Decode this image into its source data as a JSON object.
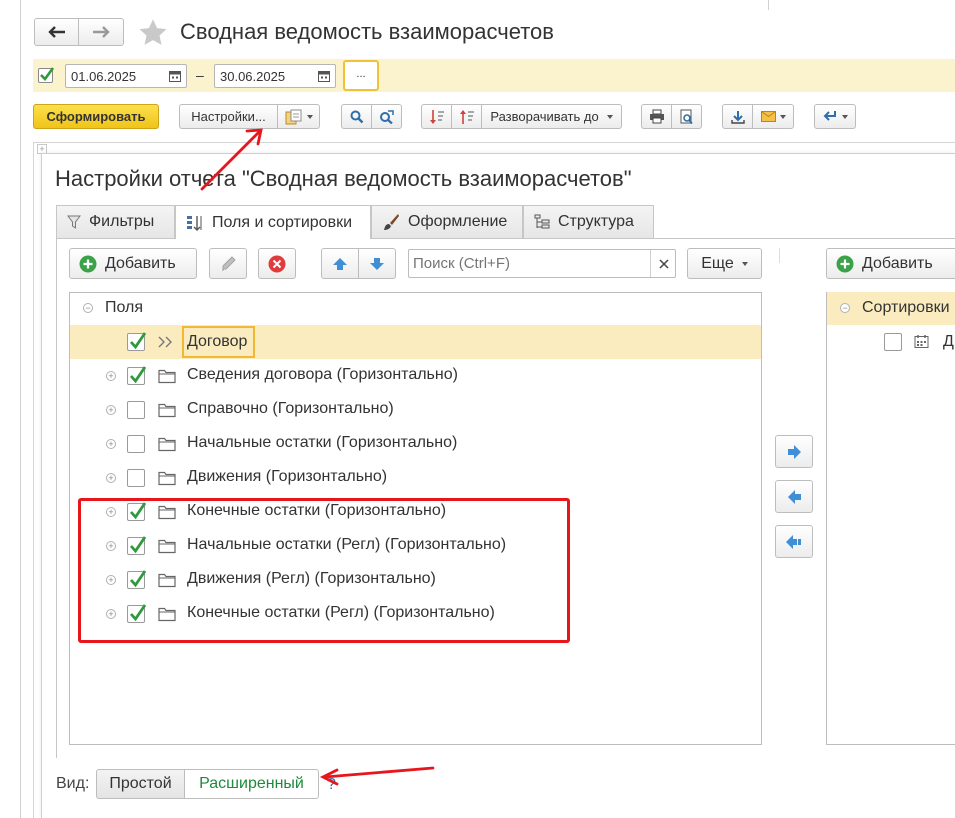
{
  "window": {
    "title": "Сводная ведомость взаиморасчетов",
    "back_label": "←",
    "forward_label": "→"
  },
  "period": {
    "enabled": true,
    "date_from": "01.06.2025",
    "separator": "–",
    "date_to": "30.06.2025",
    "more_label": "..."
  },
  "toolbar": {
    "generate_label": "Сформировать",
    "settings_label": "Настройки...",
    "expand_to_label": "Разворачивать до"
  },
  "dialog": {
    "title": "Настройки отчета \"Сводная ведомость взаиморасчетов\"",
    "tabs": [
      {
        "label": "Фильтры",
        "icon": "filter-icon",
        "active": false
      },
      {
        "label": "Поля и сортировки",
        "icon": "fields-sort-icon",
        "active": true
      },
      {
        "label": "Оформление",
        "icon": "brush-icon",
        "active": false
      },
      {
        "label": "Структура",
        "icon": "structure-icon",
        "active": false
      }
    ],
    "fields_panel": {
      "add_label": "Добавить",
      "search_placeholder": "Поиск (Ctrl+F)",
      "more_label": "Еще",
      "root_label": "Поля",
      "items": [
        {
          "label": "Договор",
          "checked": true,
          "type": "field",
          "selected": true
        },
        {
          "label": "Сведения договора (Горизонтально)",
          "checked": true,
          "type": "group"
        },
        {
          "label": "Справочно (Горизонтально)",
          "checked": false,
          "type": "group"
        },
        {
          "label": "Начальные остатки (Горизонтально)",
          "checked": false,
          "type": "group"
        },
        {
          "label": "Движения (Горизонтально)",
          "checked": false,
          "type": "group"
        },
        {
          "label": "Конечные остатки (Горизонтально)",
          "checked": true,
          "type": "group"
        },
        {
          "label": "Начальные остатки (Регл) (Горизонтально)",
          "checked": true,
          "type": "group"
        },
        {
          "label": "Движения (Регл) (Горизонтально)",
          "checked": true,
          "type": "group"
        },
        {
          "label": "Конечные остатки (Регл) (Горизонтально)",
          "checked": true,
          "type": "group"
        }
      ]
    },
    "sort_panel": {
      "add_label": "Добавить",
      "root_label": "Сортировки",
      "item_label": "Д",
      "item_checked": false
    },
    "view": {
      "label": "Вид:",
      "options": [
        "Простой",
        "Расширенный"
      ],
      "selected": "Расширенный",
      "help_label": "?"
    }
  },
  "colors": {
    "accent_yellow": "#f5d12f",
    "highlight_row": "#fbecc0",
    "selection_border": "#f1b735",
    "check_green": "#2e9a3c",
    "annotation_red": "#e8151b",
    "view_selected_text": "#1e8a3a"
  }
}
